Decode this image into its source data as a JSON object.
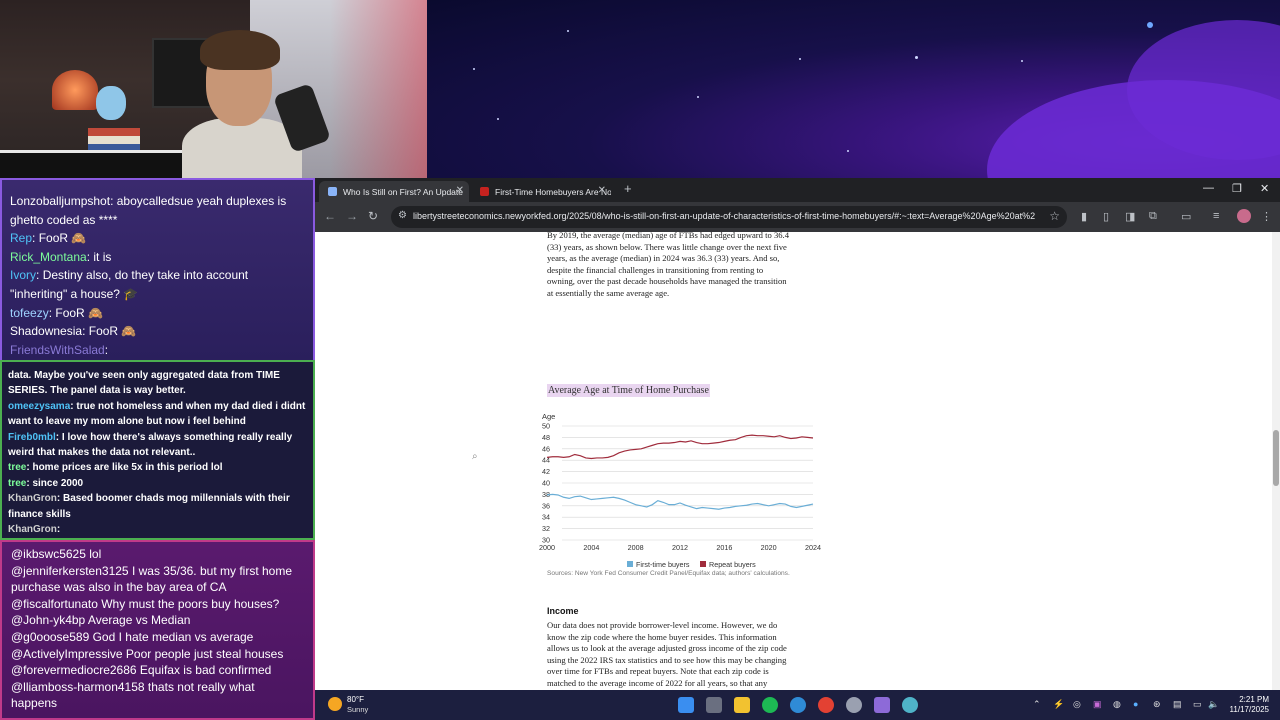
{
  "chat": {
    "top_messages": [
      {
        "user": "Lonzoballjumpshot",
        "color": "#ffffff",
        "text": "aboycalledsue yeah duplexes is ghetto coded as ****"
      },
      {
        "user": "Rep",
        "color": "#4fc3f7",
        "text": "FooR 🙈"
      },
      {
        "user": "Rick_Montana",
        "color": "#7cfc9a",
        "text": "it is"
      },
      {
        "user": "Ivory",
        "color": "#4fc3f7",
        "text": "Destiny also, do they take into account \"inheriting\" a house? 🎓"
      },
      {
        "user": "tofeezy",
        "color": "#9fd3ff",
        "text": "FooR 🙈"
      },
      {
        "user": "Shadownesia",
        "color": "#ffffff",
        "text": "FooR 🙈"
      },
      {
        "user": "FriendsWithSalad",
        "color": "#8a7ad6",
        "text": ""
      }
    ],
    "mid_messages": [
      {
        "user": "",
        "color": "#ffffff",
        "text": "data. Maybe you've seen only aggregated data from TIME SERIES. The panel data is way better."
      },
      {
        "user": "omeezysama",
        "color": "#4fc3f7",
        "text": "true not homeless and when my dad died i didnt want to leave my mom alone but now i feel behind"
      },
      {
        "user": "Fireb0mbl",
        "color": "#4fc3f7",
        "text": "I love how there's always something really really weird that makes the data not relevant.."
      },
      {
        "user": "tree",
        "color": "#7cfc9a",
        "text": "home prices are like 5x in this period lol"
      },
      {
        "user": "tree",
        "color": "#7cfc9a",
        "text": "since 2000"
      },
      {
        "user": "KhanGron",
        "color": "#cfcfcf",
        "text": "Based boomer chads mog millennials with their finance skills"
      },
      {
        "user": "KhanGron",
        "color": "#cfcfcf",
        "text": ""
      }
    ],
    "bottom_messages": [
      {
        "user": "@ikbswc5625",
        "text": "lol"
      },
      {
        "user": "@jenniferkersten3125",
        "text": "I was 35/36. but my first home purchase was also in the bay area of CA"
      },
      {
        "user": "@fiscalfortunato",
        "text": "Why must the poors buy houses?"
      },
      {
        "user": "@John-yk4bp",
        "text": "Average vs Median"
      },
      {
        "user": "@g0ooose589",
        "text": "God I hate median vs average"
      },
      {
        "user": "@ActivelyImpressive",
        "text": "Poor people just steal houses"
      },
      {
        "user": "@forevermediocre2686",
        "text": "Equifax is bad confirmed"
      },
      {
        "user": "@lliamboss-harmon4158",
        "text": "thats not really what happens"
      }
    ]
  },
  "browser": {
    "tabs": [
      {
        "label": "Who Is Still on First? An Update",
        "active": true,
        "favicon_color": "#8ab4f8"
      },
      {
        "label": "First-Time Homebuyers Are No",
        "active": false,
        "favicon_color": "#c5221f"
      }
    ],
    "new_tab_label": "+",
    "window_controls": {
      "minimize": "—",
      "restore": "❐",
      "close": "✕"
    },
    "nav": {
      "back": "←",
      "forward": "→",
      "reload": "↻"
    },
    "url": "libertystreeteconomics.newyorkfed.org/2025/08/who-is-still-on-first-an-update-of-characteristics-of-first-time-homebuyers/#:~:text=Average%20Age%20at%2..."
  },
  "article": {
    "intro_lines": [
      "By 2019, the average (median) age of FTBs had edged upward to 36.4",
      "(33) years, as shown below. There was little change over the next five",
      "years, as the average (median) in 2024 was 36.3 (33) years. And so,",
      "despite the financial challenges in transitioning from renting to",
      "owning, over the past decade households have managed the transition",
      "at essentially the same average age."
    ],
    "chart_heading": "Average Age at Time of Home Purchase",
    "source": "Sources: New York Fed Consumer Credit Panel/Equifax data; authors' calculations.",
    "income_heading": "Income",
    "income_lines": [
      "Our data does not provide borrower-level income. However, we do",
      "know the zip code where the home buyer resides. This information",
      "allows us to look at the average adjusted gross income of the zip code",
      "using the 2022 IRS tax statistics and to see how this may be changing",
      "over time for FTBs and repeat buyers. Note that each zip code is",
      "matched to the average income of 2022 for all years, so that any"
    ]
  },
  "chart_data": {
    "type": "line",
    "title": "Average Age at Time of Home Purchase",
    "ylabel": "Age",
    "xlabel": "",
    "ylim": [
      30,
      50
    ],
    "yticks": [
      30,
      32,
      34,
      36,
      38,
      40,
      42,
      44,
      46,
      48,
      50
    ],
    "xticks": [
      2000,
      2004,
      2008,
      2012,
      2016,
      2020,
      2024
    ],
    "xlim": [
      2000,
      2024
    ],
    "legend_position": "bottom",
    "x": [
      2000,
      2000.5,
      2001,
      2001.5,
      2002,
      2002.5,
      2003,
      2003.5,
      2004,
      2004.5,
      2005,
      2005.5,
      2006,
      2006.5,
      2007,
      2007.5,
      2008,
      2008.5,
      2009,
      2009.5,
      2010,
      2010.5,
      2011,
      2011.5,
      2012,
      2012.5,
      2013,
      2013.5,
      2014,
      2014.5,
      2015,
      2015.5,
      2016,
      2016.5,
      2017,
      2017.5,
      2018,
      2018.5,
      2019,
      2019.5,
      2020,
      2020.5,
      2021,
      2021.5,
      2022,
      2022.5,
      2023,
      2023.5,
      2024
    ],
    "series": [
      {
        "name": "First-time buyers",
        "color": "#6aaed6",
        "values": [
          37.9,
          38.0,
          37.9,
          37.5,
          37.3,
          37.6,
          37.7,
          37.4,
          37.1,
          37.2,
          37.3,
          37.4,
          37.5,
          37.3,
          37.0,
          36.6,
          36.2,
          36.0,
          35.8,
          36.2,
          36.9,
          36.6,
          36.2,
          36.2,
          36.5,
          36.1,
          35.8,
          35.5,
          35.7,
          35.6,
          35.5,
          35.4,
          35.6,
          35.7,
          35.9,
          36.0,
          36.1,
          36.3,
          36.4,
          36.2,
          36.0,
          36.2,
          36.4,
          36.3,
          35.9,
          35.7,
          35.9,
          36.1,
          36.3
        ]
      },
      {
        "name": "Repeat buyers",
        "color": "#a02c3c",
        "values": [
          44.5,
          44.6,
          44.6,
          44.5,
          44.6,
          45.0,
          44.8,
          44.4,
          44.3,
          44.4,
          44.4,
          44.5,
          44.8,
          45.3,
          45.6,
          45.8,
          45.9,
          46.0,
          46.3,
          46.6,
          46.9,
          47.0,
          47.0,
          47.1,
          47.3,
          47.2,
          47.4,
          47.1,
          46.9,
          46.9,
          47.0,
          47.1,
          47.3,
          47.5,
          47.6,
          48.0,
          48.3,
          48.4,
          48.3,
          48.3,
          48.2,
          48.1,
          48.3,
          48.0,
          47.8,
          47.9,
          48.1,
          48.0,
          47.9
        ]
      }
    ]
  },
  "taskbar": {
    "weather_temp": "80°F",
    "weather_desc": "Sunny",
    "time": "2:21 PM",
    "date": "11/17/2025"
  }
}
